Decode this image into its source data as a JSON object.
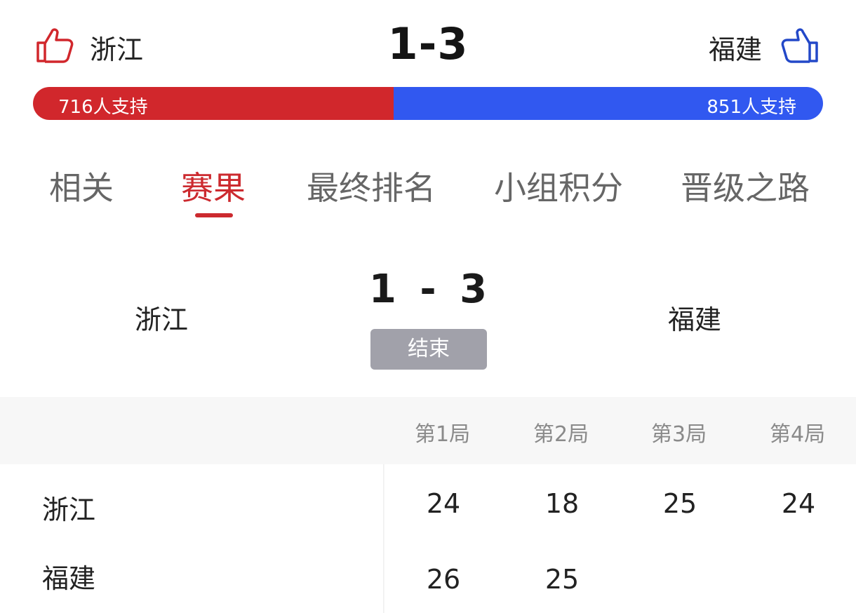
{
  "header": {
    "home_team": "浙江",
    "away_team": "福建",
    "score": "1-3",
    "home_thumb_icon": "thumbs-up-outline-red",
    "away_thumb_icon": "thumbs-up-outline-blue"
  },
  "support": {
    "home_count": 716,
    "away_count": 851,
    "home_label": "716人支持",
    "away_label": "851人支持",
    "home_color": "#d1272c",
    "away_color": "#3158f0"
  },
  "tabs": [
    {
      "label": "相关",
      "active": false
    },
    {
      "label": "赛果",
      "active": true
    },
    {
      "label": "最终排名",
      "active": false
    },
    {
      "label": "小组积分",
      "active": false
    },
    {
      "label": "晋级之路",
      "active": false
    }
  ],
  "match": {
    "home_team": "浙江",
    "away_team": "福建",
    "score": "1 - 3",
    "status": "结束"
  },
  "scoreboard": {
    "set_headers": [
      "第1局",
      "第2局",
      "第3局",
      "第4局"
    ],
    "rows": [
      {
        "team": "浙江",
        "scores": [
          "24",
          "18",
          "25",
          "24"
        ]
      },
      {
        "team": "福建",
        "scores": [
          "26",
          "25",
          "",
          ""
        ]
      }
    ]
  }
}
